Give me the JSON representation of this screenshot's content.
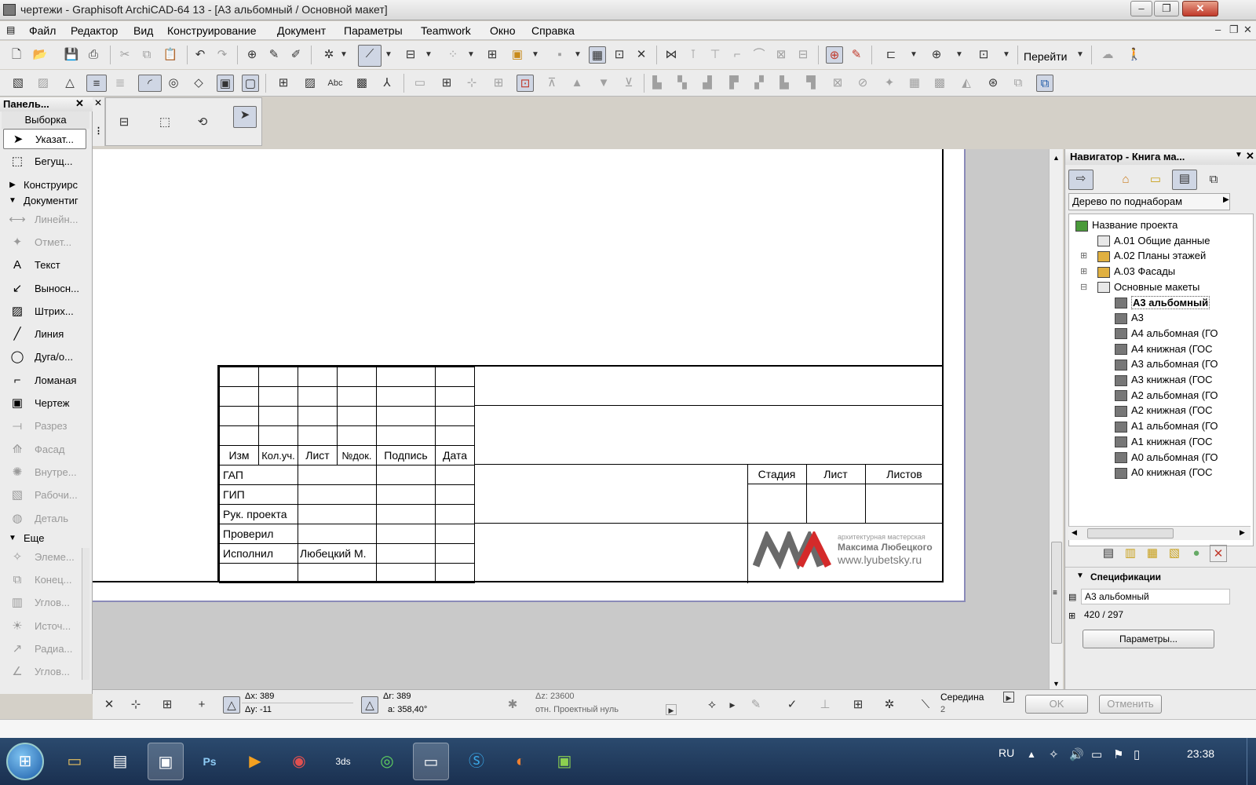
{
  "window": {
    "title": "чертежи - Graphisoft ArchiCAD-64 13 - [А3 альбомный / Основной макет]"
  },
  "menu": [
    "Файл",
    "Редактор",
    "Вид",
    "Конструирование",
    "Документ",
    "Параметры",
    "Teamwork",
    "Окно",
    "Справка"
  ],
  "toolbar": {
    "goto_label": "Перейти"
  },
  "toolbox": {
    "title": "Панель...",
    "section_select": "Выборка",
    "items": [
      {
        "icon": "arrow-icon",
        "label": "Указат...",
        "state": "selected"
      },
      {
        "icon": "marquee-icon",
        "label": "Бегущ..."
      },
      {
        "label": "Конструирс",
        "type": "group-collapsed"
      },
      {
        "label": "Документиг",
        "type": "group-expanded"
      },
      {
        "label": "Линейн...",
        "state": "disabled"
      },
      {
        "label": "Отмет...",
        "state": "disabled"
      },
      {
        "label": "Текст"
      },
      {
        "label": "Выносн..."
      },
      {
        "label": "Штрих..."
      },
      {
        "label": "Линия"
      },
      {
        "label": "Дуга/о..."
      },
      {
        "label": "Ломаная"
      },
      {
        "label": "Чертеж"
      },
      {
        "label": "Разрез",
        "state": "disabled"
      },
      {
        "label": "Фасад",
        "state": "disabled"
      },
      {
        "label": "Внутре...",
        "state": "disabled"
      },
      {
        "label": "Рабочи...",
        "state": "disabled"
      },
      {
        "label": "Деталь",
        "state": "disabled"
      },
      {
        "label": "Еще",
        "type": "group-expanded"
      },
      {
        "label": "Элеме...",
        "state": "disabled"
      },
      {
        "label": "Конец...",
        "state": "disabled"
      },
      {
        "label": "Углов...",
        "state": "disabled"
      },
      {
        "label": "Источ...",
        "state": "disabled"
      },
      {
        "label": "Радиа...",
        "state": "disabled"
      },
      {
        "label": "Углов...",
        "state": "disabled"
      }
    ]
  },
  "title_block": {
    "col_headers": [
      "Изм",
      "Кол.уч.",
      "Лист",
      "№док.",
      "Подпись",
      "Дата"
    ],
    "roles": [
      "ГАП",
      "ГИП",
      "Рук. проекта",
      "Проверил",
      "Исполнил"
    ],
    "executor_name": "Любецкий М.",
    "stage_headers": [
      "Стадия",
      "Лист",
      "Листов"
    ],
    "logo_lines": [
      "архитектурная мастерская",
      "Максима Любецкого",
      "www.lyubetsky.ru"
    ]
  },
  "navigator": {
    "title": "Навигатор - Книга ма...",
    "view_mode": "Дерево по поднаборам",
    "tree": [
      {
        "label": "Название проекта",
        "level": 0
      },
      {
        "label": "А.01 Общие данные",
        "level": 1
      },
      {
        "label": "А.02 Планы этажей",
        "level": 1
      },
      {
        "label": "А.03 Фасады",
        "level": 1
      },
      {
        "label": "Основные макеты",
        "level": 1
      },
      {
        "label": "А3 альбомный",
        "level": 2,
        "selected": true
      },
      {
        "label": "А3",
        "level": 2
      },
      {
        "label": "А4 альбомная (ГО",
        "level": 2
      },
      {
        "label": "А4 книжная (ГОС",
        "level": 2
      },
      {
        "label": "А3 альбомная (ГО",
        "level": 2
      },
      {
        "label": "А3 книжная (ГОС",
        "level": 2
      },
      {
        "label": "А2 альбомная (ГО",
        "level": 2
      },
      {
        "label": "А2 книжная (ГОС",
        "level": 2
      },
      {
        "label": "А1 альбомная (ГО",
        "level": 2
      },
      {
        "label": "А1 книжная (ГОС",
        "level": 2
      },
      {
        "label": "А0 альбомная (ГО",
        "level": 2
      },
      {
        "label": "А0 книжная (ГОС",
        "level": 2
      }
    ],
    "spec_header": "Спецификации",
    "spec_name": "А3 альбомный",
    "spec_size": "420 / 297",
    "params_button": "Параметры..."
  },
  "status": {
    "dx": "Δx: 389",
    "dy": "Δy: -11",
    "dr": "Δr: 389",
    "a": "a: 358,40°",
    "dz": "Δz: 23600",
    "ref": "отн. Проектный нуль",
    "snap_label": "Середина",
    "snap_value": "2",
    "ok": "OK",
    "cancel": "Отменить"
  },
  "taskbar": {
    "lang": "RU",
    "time": "23:38"
  }
}
